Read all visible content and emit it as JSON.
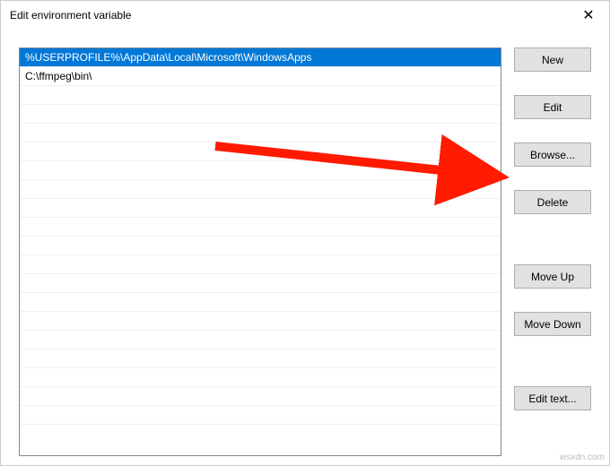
{
  "window": {
    "title": "Edit environment variable",
    "close_glyph": "✕"
  },
  "list": {
    "items": [
      "%USERPROFILE%\\AppData\\Local\\Microsoft\\WindowsApps",
      "C:\\ffmpeg\\bin\\"
    ],
    "selected_index": 0,
    "visible_rows": 20
  },
  "buttons": {
    "new": "New",
    "edit": "Edit",
    "browse": "Browse...",
    "delete": "Delete",
    "move_up": "Move Up",
    "move_down": "Move Down",
    "edit_text": "Edit text..."
  },
  "annotation": {
    "arrow_target": "browse-button",
    "arrow_color": "#ff1a00"
  },
  "watermark": "wsxdn.com"
}
